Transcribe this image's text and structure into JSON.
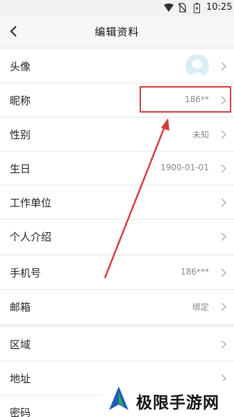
{
  "status_bar": {
    "time": "10:25",
    "icons": [
      "wifi-icon",
      "no-sim-icon",
      "battery-icon"
    ]
  },
  "header": {
    "title": "编辑资料",
    "back_icon": "chevron-left-icon"
  },
  "groups": [
    {
      "rows": [
        {
          "label": "头像",
          "value": "",
          "type": "avatar"
        },
        {
          "label": "昵称",
          "value": "186**"
        },
        {
          "label": "性别",
          "value": "未知"
        },
        {
          "label": "生日",
          "value": "1900-01-01"
        },
        {
          "label": "工作单位",
          "value": ""
        },
        {
          "label": "个人介绍",
          "value": ""
        }
      ]
    },
    {
      "rows": [
        {
          "label": "手机号",
          "value": "186***"
        },
        {
          "label": "邮箱",
          "value": "绑定"
        }
      ]
    },
    {
      "rows": [
        {
          "label": "区域",
          "value": ""
        },
        {
          "label": "地址",
          "value": ""
        },
        {
          "label": "密码",
          "value": ""
        }
      ]
    }
  ],
  "annotation": {
    "color": "#d63b3b"
  },
  "watermark": {
    "text": "极限手游网"
  }
}
